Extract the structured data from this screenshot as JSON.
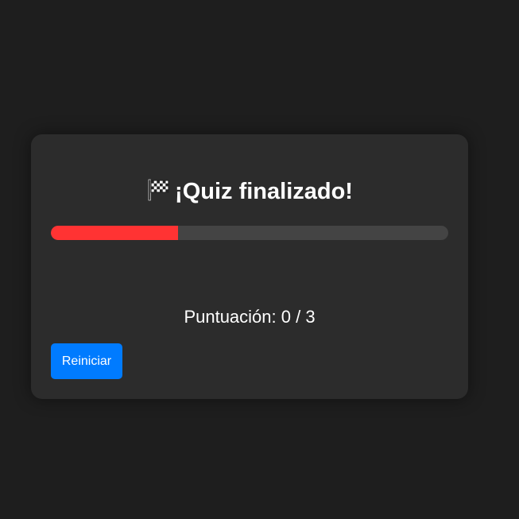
{
  "quiz": {
    "title": "¡Quiz finalizado!",
    "title_icon": "checkered-flag-icon",
    "progress_fraction": 0.32,
    "score_text": "Puntuación: 0 / 3",
    "restart_label": "Reiniciar"
  },
  "colors": {
    "page_background": "#1e1e1e",
    "card_background": "#2c2c2c",
    "progress_track": "#444444",
    "progress_fill": "#ff3333",
    "button_background": "#007bff",
    "text": "#ffffff"
  }
}
